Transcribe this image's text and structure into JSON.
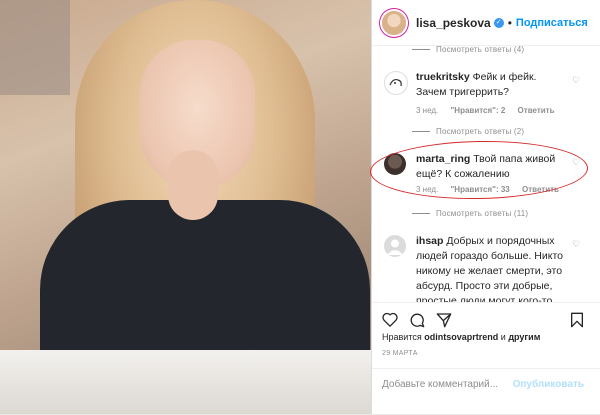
{
  "header": {
    "username": "lisa_peskova",
    "separator": "•",
    "follow_label": "Подписаться"
  },
  "thread_top": {
    "label": "Посмотреть ответы (4)"
  },
  "comments": [
    {
      "username": "truekritsky",
      "text": "Фейк и фейк. Зачем тригеррить?",
      "time": "3 нед.",
      "likes": "\"Нравится\": 2",
      "reply": "Ответить"
    },
    {
      "username": "marta_ring",
      "text": "Твой папа живой ещё? К сожалению",
      "time": "3 нед.",
      "likes": "\"Нравится\": 33",
      "reply": "Ответить",
      "thread": "Посмотреть ответы (11)"
    },
    {
      "username": "ihsap",
      "text": "Добрых и порядочных людей гораздо больше. Никто никому не желает смерти, это абсурд. Просто эти добрые, простые люди могут кого-то"
    }
  ],
  "thread_mid": {
    "label": "Посмотреть ответы (2)"
  },
  "likes": {
    "prefix": "Нравится",
    "user": "odintsovaprtrend",
    "conj": "и",
    "others": "другим"
  },
  "date": "29 МАРТА",
  "add_comment": {
    "placeholder": "Добавьте комментарий...",
    "publish": "Опубликовать"
  },
  "colors": {
    "accent": "#0095f6",
    "highlight": "#d42a2a"
  }
}
